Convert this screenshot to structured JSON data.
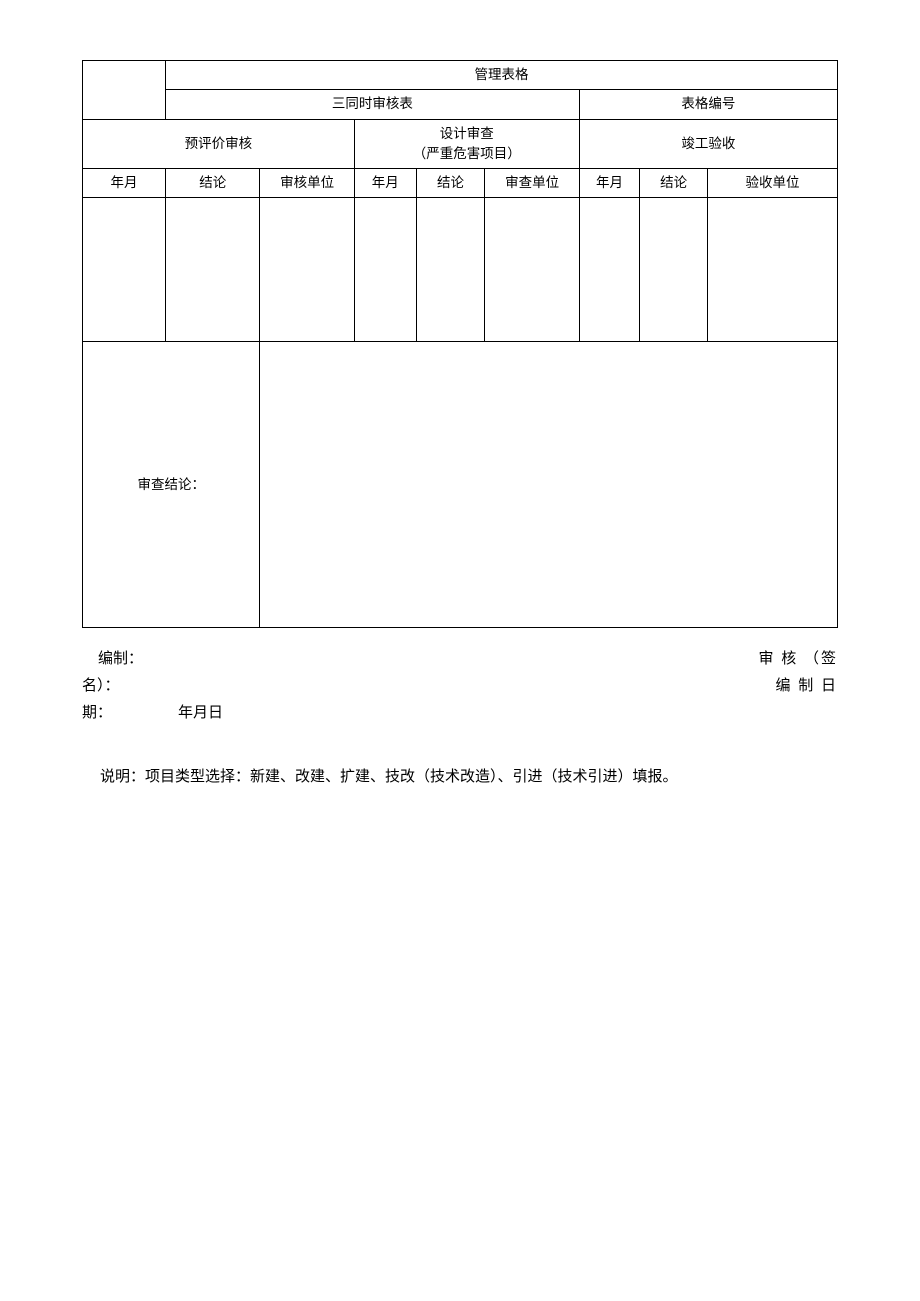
{
  "header": {
    "title": "管理表格",
    "subtitle": "三同时审核表",
    "form_number_label": "表格编号"
  },
  "sections": {
    "pre_eval": "预评价审核",
    "design_review_line1": "设计审查",
    "design_review_line2": "（严重危害项目）",
    "completion": "竣工验收"
  },
  "columns": {
    "year_month": "年月",
    "conclusion": "结论",
    "audit_unit": "审核单位",
    "review_unit": "审查单位",
    "accept_unit": "验收单位"
  },
  "conclusion_label": "审查结论：",
  "footer": {
    "prepared_by": "编制：",
    "reviewed_sign_right": "审 核 （签",
    "name_label": "名）：",
    "prepared_date_right": "编 制  日",
    "period_label": "期：",
    "date_text": "年月日"
  },
  "note": "说明：项目类型选择：新建、改建、扩建、技改（技术改造）、引进（技术引进）填报。"
}
